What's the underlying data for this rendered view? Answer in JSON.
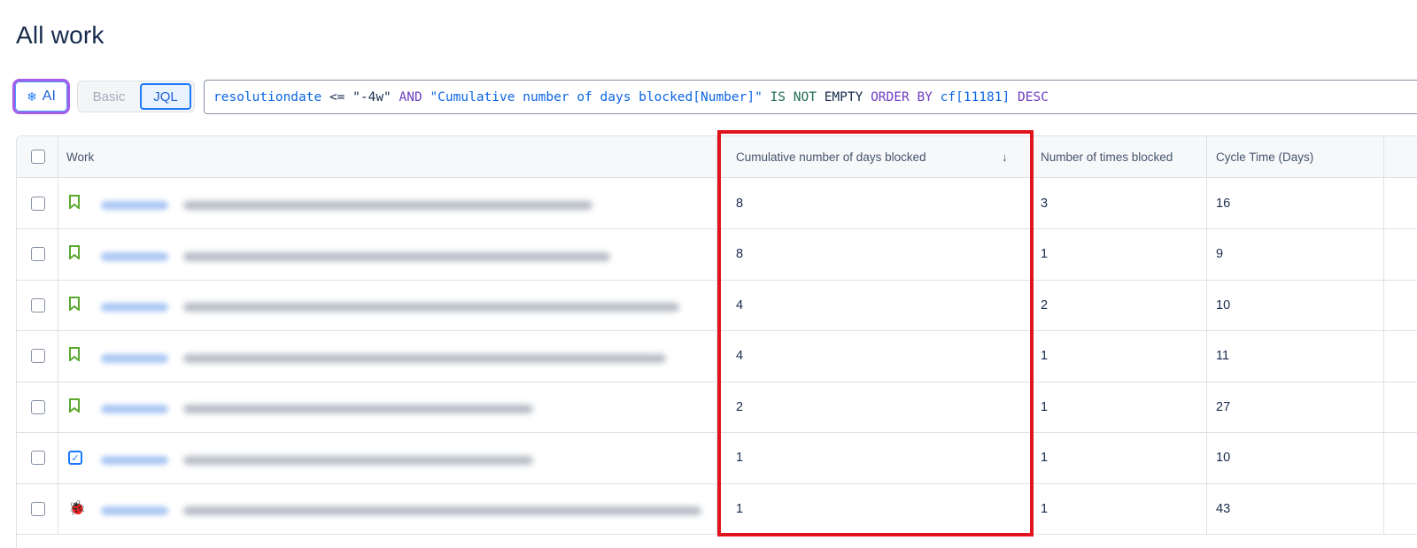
{
  "page": {
    "title": "All work"
  },
  "search": {
    "ai_label": "AI",
    "mode_basic": "Basic",
    "mode_jql": "JQL",
    "jql_tokens": [
      {
        "t": "resolutiondate",
        "c": "tok-field"
      },
      {
        "t": " <= ",
        "c": "tok-op"
      },
      {
        "t": "\"-4w\"",
        "c": "tok-str"
      },
      {
        "t": " AND ",
        "c": "tok-kw"
      },
      {
        "t": "\"Cumulative number of days blocked[Number]\"",
        "c": "tok-field"
      },
      {
        "t": " IS NOT ",
        "c": "tok-green"
      },
      {
        "t": "EMPTY",
        "c": "tok-op"
      },
      {
        "t": " ORDER BY ",
        "c": "tok-kw"
      },
      {
        "t": "cf[11181]",
        "c": "tok-num"
      },
      {
        "t": " DESC",
        "c": "tok-kw"
      }
    ]
  },
  "table": {
    "columns": {
      "work": "Work",
      "days_blocked": "Cumulative number of days blocked",
      "times_blocked": "Number of times blocked",
      "cycle_time": "Cycle Time (Days)"
    },
    "sort_indicator": "↓",
    "rows": [
      {
        "type": "story",
        "days_blocked": "8",
        "times_blocked": "3",
        "cycle_time": "16"
      },
      {
        "type": "story",
        "days_blocked": "8",
        "times_blocked": "1",
        "cycle_time": "9"
      },
      {
        "type": "story",
        "days_blocked": "4",
        "times_blocked": "2",
        "cycle_time": "10"
      },
      {
        "type": "story",
        "days_blocked": "4",
        "times_blocked": "1",
        "cycle_time": "11"
      },
      {
        "type": "story",
        "days_blocked": "2",
        "times_blocked": "1",
        "cycle_time": "27"
      },
      {
        "type": "task",
        "days_blocked": "1",
        "times_blocked": "1",
        "cycle_time": "10"
      },
      {
        "type": "bug",
        "days_blocked": "1",
        "times_blocked": "1",
        "cycle_time": "43"
      }
    ]
  },
  "icons": {
    "ai": "sparkle-icon",
    "story": "bookmark-icon",
    "task": "checkbox-icon",
    "bug": "bug-icon",
    "sort": "arrow-down-icon"
  },
  "colors": {
    "highlight": "#e0141c",
    "ai_border": "#a35de8",
    "link": "#1d5fd6",
    "story": "#5ba82e"
  }
}
